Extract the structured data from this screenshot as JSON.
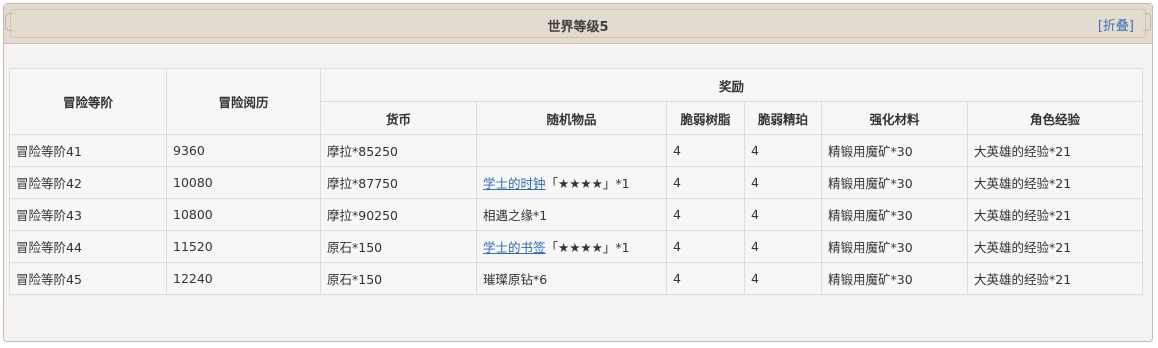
{
  "panel": {
    "title": "世界等级5",
    "toggle_bracket_open": "[",
    "toggle_label": "折叠",
    "toggle_bracket_close": "]"
  },
  "table": {
    "headers": {
      "rank": "冒险等阶",
      "exp": "冒险阅历",
      "reward": "奖励",
      "currency": "货币",
      "random_item": "随机物品",
      "fragile_resin": "脆弱树脂",
      "fragile_amber": "脆弱精珀",
      "enhance_material": "强化材料",
      "char_exp": "角色经验"
    },
    "rows": [
      {
        "rank": "冒险等阶41",
        "exp": "9360",
        "currency": "摩拉*85250",
        "item_link": "",
        "item_suffix": "",
        "resin": "4",
        "amber": "4",
        "material": "精锻用魔矿*30",
        "charexp": "大英雄的经验*21"
      },
      {
        "rank": "冒险等阶42",
        "exp": "10080",
        "currency": "摩拉*87750",
        "item_link": "学士的时钟",
        "item_suffix": "「★★★★」*1",
        "resin": "4",
        "amber": "4",
        "material": "精锻用魔矿*30",
        "charexp": "大英雄的经验*21"
      },
      {
        "rank": "冒险等阶43",
        "exp": "10800",
        "currency": "摩拉*90250",
        "item_link": "",
        "item_suffix": "相遇之缘*1",
        "resin": "4",
        "amber": "4",
        "material": "精锻用魔矿*30",
        "charexp": "大英雄的经验*21"
      },
      {
        "rank": "冒险等阶44",
        "exp": "11520",
        "currency": "原石*150",
        "item_link": "学士的书签",
        "item_suffix": "「★★★★」*1",
        "resin": "4",
        "amber": "4",
        "material": "精锻用魔矿*30",
        "charexp": "大英雄的经验*21"
      },
      {
        "rank": "冒险等阶45",
        "exp": "12240",
        "currency": "原石*150",
        "item_link": "",
        "item_suffix": "璀璨原钻*6",
        "resin": "4",
        "amber": "4",
        "material": "精锻用魔矿*30",
        "charexp": "大英雄的经验*21"
      }
    ]
  }
}
